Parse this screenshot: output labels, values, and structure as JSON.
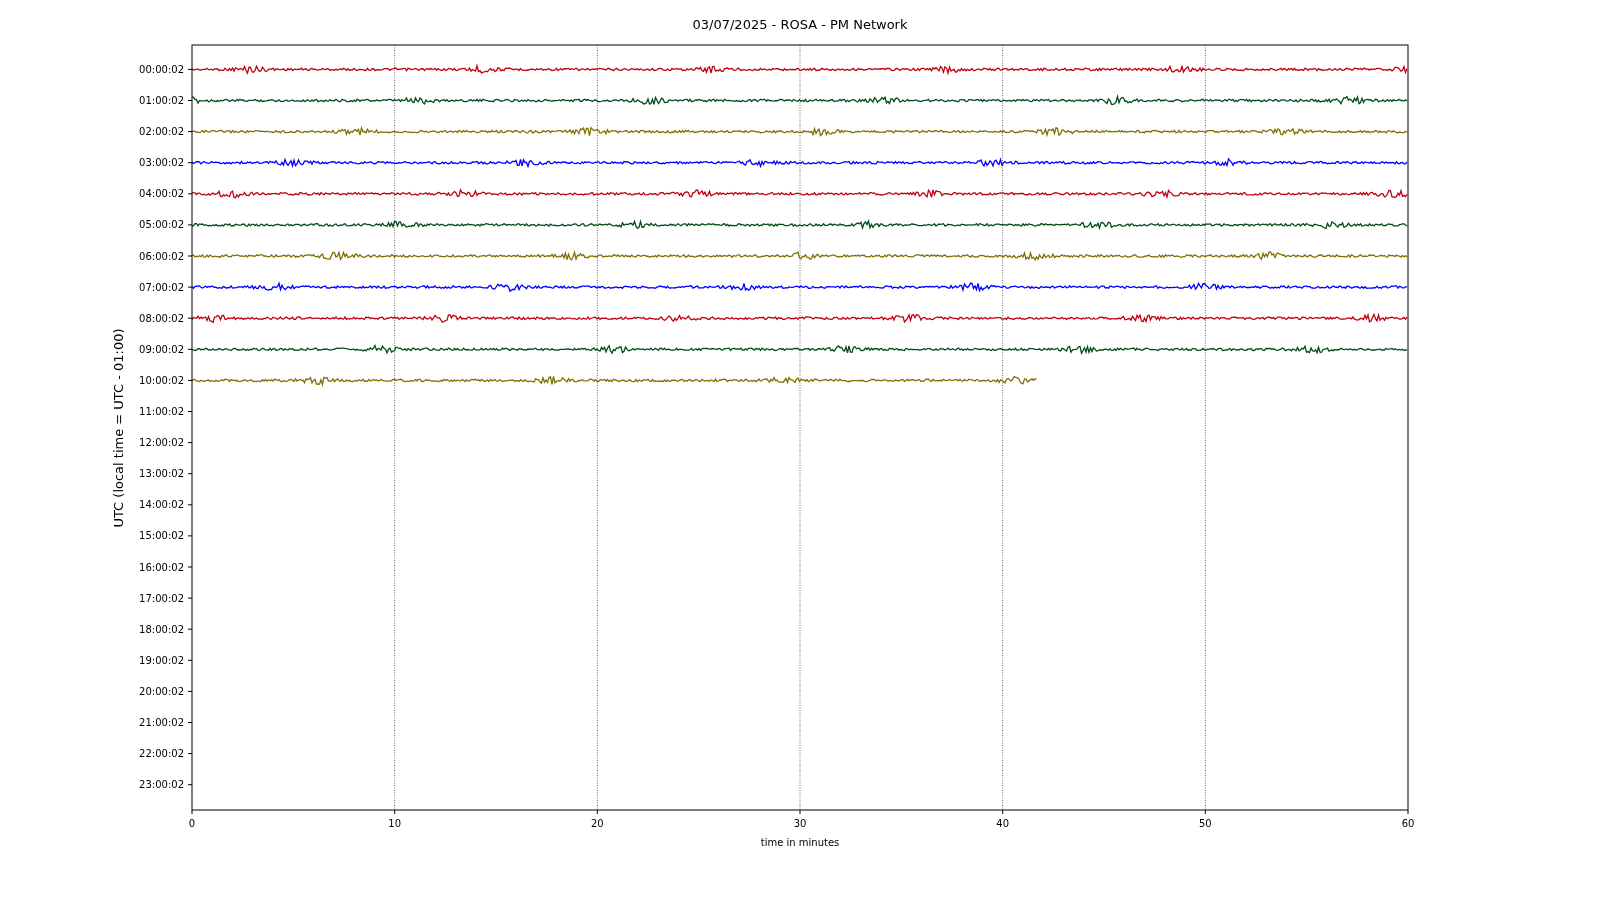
{
  "title": "03/07/2025 - ROSA - PM Network",
  "y_axis": {
    "label": "UTC (local time = UTC - 01:00)",
    "ticks": [
      "00:00:02",
      "01:00:02",
      "02:00:02",
      "03:00:02",
      "04:00:02",
      "05:00:02",
      "06:00:02",
      "07:00:02",
      "08:00:02",
      "09:00:02",
      "10:00:02",
      "11:00:02",
      "12:00:02",
      "13:00:02",
      "14:00:02",
      "15:00:02",
      "16:00:02",
      "17:00:02",
      "18:00:02",
      "19:00:02",
      "20:00:02",
      "21:00:02",
      "22:00:02",
      "23:00:02"
    ]
  },
  "x_axis": {
    "label": "time in minutes",
    "ticks": [
      "0",
      "10",
      "20",
      "30",
      "40",
      "50",
      "60"
    ]
  },
  "traces": [
    {
      "color": "#c0000f",
      "level": 1
    },
    {
      "color": "#004d1a",
      "level": 1
    },
    {
      "color": "#807000",
      "level": 1
    },
    {
      "color": "#0000ff",
      "level": 1
    },
    {
      "color": "#c0000f",
      "level": 1
    },
    {
      "color": "#004d1a",
      "level": 1
    },
    {
      "color": "#807000",
      "level": 1
    },
    {
      "color": "#0000ff",
      "level": 1
    },
    {
      "color": "#c0000f",
      "level": 1
    },
    {
      "color": "#004d1a",
      "level": 1
    },
    {
      "color": "#807000",
      "level": 0.695
    }
  ]
}
